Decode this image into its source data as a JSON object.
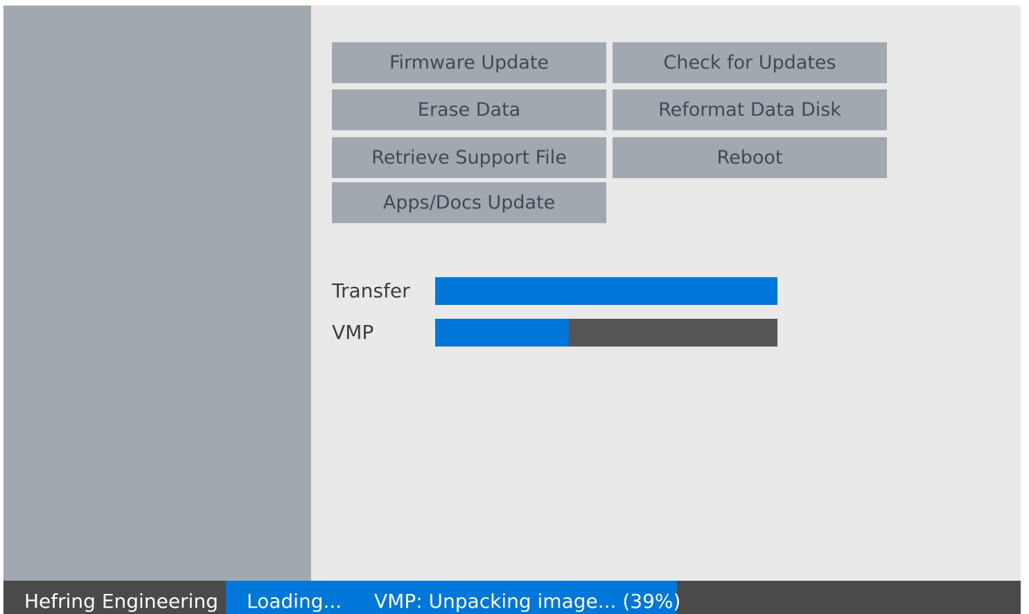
{
  "buttons": {
    "firmware_update": "Firmware Update",
    "check_for_updates": "Check for Updates",
    "erase_data": "Erase Data",
    "reformat_data_disk": "Reformat Data Disk",
    "retrieve_support_file": "Retrieve Support File",
    "reboot": "Reboot",
    "apps_docs_update": "Apps/Docs Update"
  },
  "progress": {
    "transfer": {
      "label": "Transfer",
      "fraction": 1.0
    },
    "vmp": {
      "label": "VMP",
      "fraction": 0.39
    }
  },
  "status_bar": {
    "brand": "Hefring Engineering",
    "loading": "Loading...",
    "detail": "VMP: Unpacking image... (39%)"
  },
  "colors": {
    "accent": "#0077d9",
    "sidebar": "#a2a8b0",
    "track": "#555555",
    "status_bar": "#4a4a4a"
  }
}
